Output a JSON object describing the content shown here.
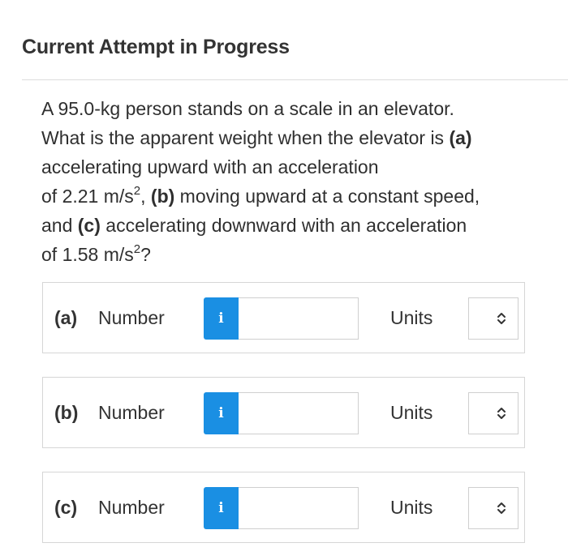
{
  "header": {
    "title": "Current Attempt in Progress"
  },
  "question": {
    "line1": "A 95.0-kg person stands on a scale in an elevator.",
    "line2_pre": "What is the apparent weight when the elevator is ",
    "a_tag": "(a)",
    "line3": "accelerating upward with an acceleration",
    "line4_pre": "of 2.21 m/s",
    "exp1": "2",
    "line4_mid": ", ",
    "b_tag": "(b)",
    "line4_post": " moving upward at a constant speed,",
    "line5_pre": "and ",
    "c_tag": "(c)",
    "line5_post": " accelerating downward with an acceleration",
    "line6_pre": "of 1.58 m/s",
    "exp2": "2",
    "line6_post": "?"
  },
  "answers": [
    {
      "part": "(a)",
      "number_label": "Number",
      "info_icon": "i",
      "value": "",
      "units_label": "Units",
      "units_value": ""
    },
    {
      "part": "(b)",
      "number_label": "Number",
      "info_icon": "i",
      "value": "",
      "units_label": "Units",
      "units_value": ""
    },
    {
      "part": "(c)",
      "number_label": "Number",
      "info_icon": "i",
      "value": "",
      "units_label": "Units",
      "units_value": ""
    }
  ],
  "colors": {
    "info_button": "#1a8fe3",
    "border": "#d6d6d6",
    "text": "#333333"
  }
}
